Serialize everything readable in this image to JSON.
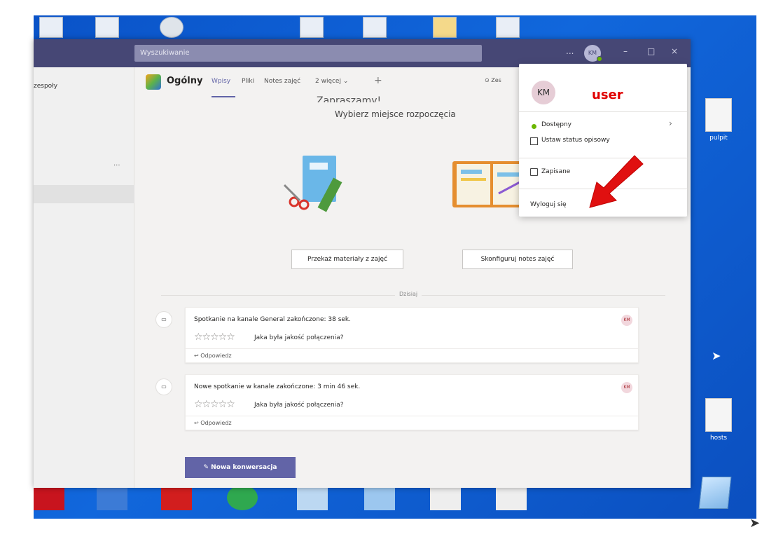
{
  "titlebar": {
    "search_placeholder": "Wyszukiwanie",
    "more_label": "...",
    "avatar_initials": "KM"
  },
  "window_controls": {
    "minimize": "–",
    "maximize": "□",
    "close": "×"
  },
  "left_panel": {
    "title": "zespoły",
    "more": "..."
  },
  "channel": {
    "name": "Ogólny",
    "tabs": [
      {
        "label": "Wpisy",
        "active": true
      },
      {
        "label": "Pliki",
        "active": false
      },
      {
        "label": "Notes zajęć",
        "active": false
      },
      {
        "label": "2 więcej ⌄",
        "active": false
      }
    ],
    "add_tab": "+",
    "team_button": "⊙ Zes"
  },
  "welcome": {
    "heading": "Zapraszamy!",
    "subtitle": "Wybierz miejsce rozpoczęcia",
    "btn_materials": "Przekaż materiały z zajęć",
    "btn_notes": "Skonfiguruj notes zajęć"
  },
  "feed": {
    "day_label": "Dzisiaj",
    "messages": [
      {
        "title": "Spotkanie na kanale General zakończone: 38 sek.",
        "stars": "☆☆☆☆☆",
        "question": "Jaka była jakość połączenia?",
        "reply": "↩ Odpowiedz",
        "avatar": "KM"
      },
      {
        "title": "Nowe spotkanie w kanale zakończone: 3 min 46 sek.",
        "stars": "☆☆☆☆☆",
        "question": "Jaka była jakość połączenia?",
        "reply": "↩ Odpowiedz",
        "avatar": "KM"
      }
    ],
    "new_conversation": "Nowa konwersacja",
    "new_conversation_icon": "✎"
  },
  "profile_menu": {
    "initials": "KM",
    "user_label": "user",
    "status": "Dostępny",
    "status_chevron": "›",
    "set_status": "Ustaw status opisowy",
    "saved": "Zapisane",
    "sign_out": "Wyloguj się"
  },
  "desktop": {
    "icons": [
      {
        "label": "pulpit"
      },
      {
        "label": "hosts"
      }
    ]
  },
  "colors": {
    "teams_purple": "#464775",
    "accent": "#6264a7",
    "annotation_red": "#e00000",
    "presence_green": "#6bb700"
  }
}
